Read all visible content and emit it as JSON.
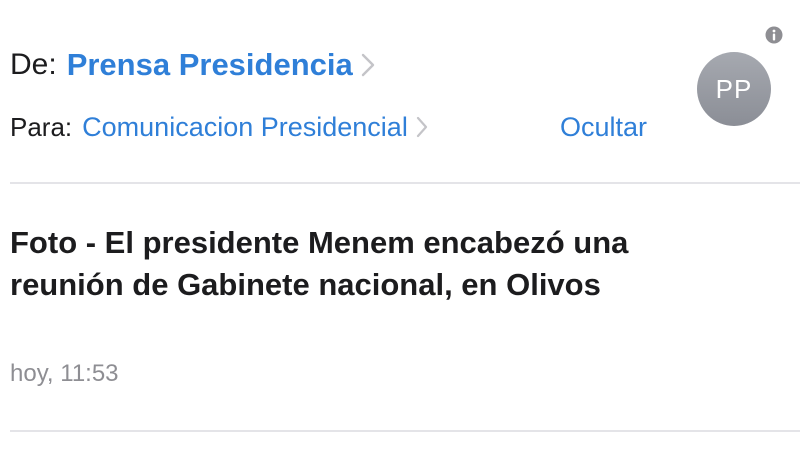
{
  "header": {
    "from_label": "De:",
    "from_sender": "Prensa Presidencia",
    "to_label": "Para:",
    "to_recipient": "Comunicacion Presidencial",
    "hide_label": "Ocultar",
    "avatar_initials": "PP",
    "info_icon": "info-icon",
    "chevron_icon": "chevron-right-icon"
  },
  "message": {
    "subject": "Foto - El presidente Menem encabezó una reunión de Gabinete nacional, en Olivos",
    "timestamp": "hoy, 11:53"
  },
  "colors": {
    "link_blue": "#2f7fd8",
    "text": "#1c1c1e",
    "secondary_text": "#8e8e93",
    "chevron": "#c4c4c8",
    "avatar_bg": "#9a9da4",
    "divider": "#e4e4e8"
  }
}
